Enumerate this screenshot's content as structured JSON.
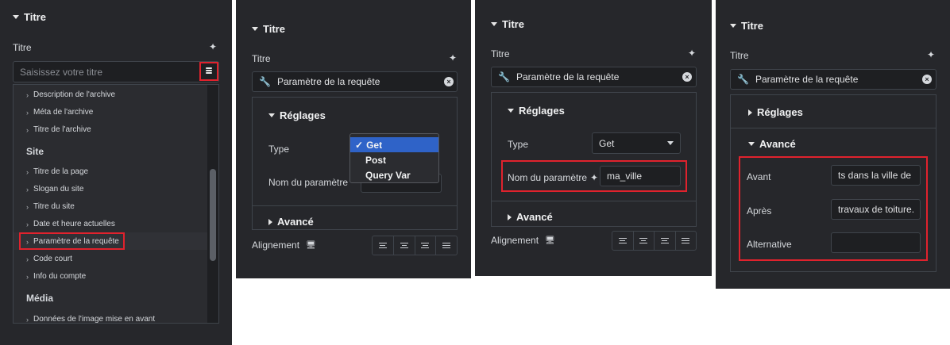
{
  "panel1": {
    "section_title": "Titre",
    "title_label": "Titre",
    "title_placeholder": "Saisissez votre titre",
    "items_top": [
      "Description de l'archive",
      "Méta de l'archive",
      "Titre de l'archive"
    ],
    "group_site": "Site",
    "items_site": [
      "Titre de la page",
      "Slogan du site",
      "Titre du site",
      "Date et heure actuelles",
      "Paramètre de la requête",
      "Code court",
      "Info du compte"
    ],
    "group_media": "Média",
    "items_media": [
      "Données de l'image mise en avant"
    ]
  },
  "panel2": {
    "section_title": "Titre",
    "title_label": "Titre",
    "field_value": "Paramètre de la requête",
    "reglages": "Réglages",
    "type_label": "Type",
    "dropdown_options": [
      "Get",
      "Post",
      "Query Var"
    ],
    "param_label": "Nom du paramètre",
    "avance": "Avancé",
    "alignement": "Alignement"
  },
  "panel3": {
    "section_title": "Titre",
    "title_label": "Titre",
    "field_value": "Paramètre de la requête",
    "reglages": "Réglages",
    "type_label": "Type",
    "type_value": "Get",
    "param_label": "Nom du paramètre",
    "param_value": "ma_ville",
    "avance": "Avancé",
    "alignement": "Alignement"
  },
  "panel4": {
    "section_title": "Titre",
    "title_label": "Titre",
    "field_value": "Paramètre de la requête",
    "reglages": "Réglages",
    "avance": "Avancé",
    "avant_label": "Avant",
    "avant_value": "ts dans la ville de",
    "apres_label": "Après",
    "apres_value": "travaux de toiture.",
    "alternative_label": "Alternative",
    "alternative_value": ""
  },
  "colors": {
    "panel_bg": "#26272b",
    "highlight": "#e0222d",
    "selected": "#2f63c8"
  }
}
